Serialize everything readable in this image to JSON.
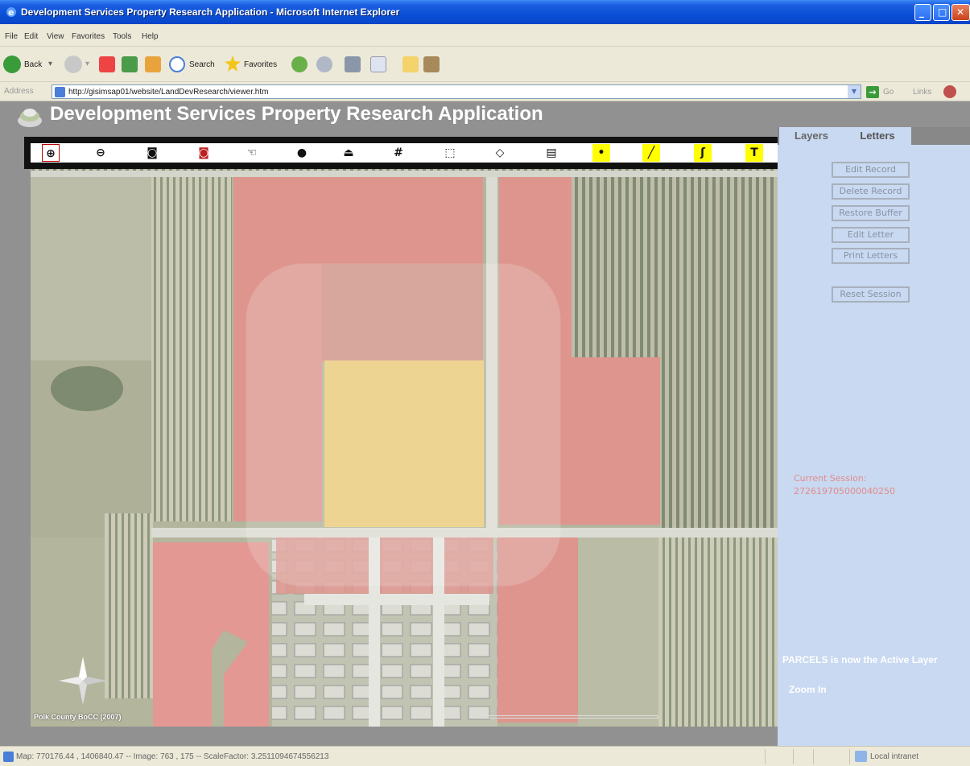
{
  "window": {
    "title": "Development Services Property Research Application - Microsoft Internet Explorer"
  },
  "menu": [
    "File",
    "Edit",
    "View",
    "Favorites",
    "Tools",
    "Help"
  ],
  "toolbar": {
    "back_label": "Back",
    "search_label": "Search",
    "favorites_label": "Favorites"
  },
  "address": {
    "label": "Address",
    "url": "http://gisimsap01/website/LandDevResearch/viewer.htm",
    "go_label": "Go",
    "links_label": "Links"
  },
  "app": {
    "title": "Development Services Property Research Application"
  },
  "map_tools": [
    {
      "name": "zoom-in-tool",
      "icon": "zoom-in-icon",
      "glyph": "⊕"
    },
    {
      "name": "zoom-out-tool",
      "icon": "zoom-out-icon",
      "glyph": "⊖"
    },
    {
      "name": "zoom-full-tool",
      "icon": "globe-icon",
      "glyph": "◙"
    },
    {
      "name": "zoom-active-tool",
      "icon": "globe-red-icon",
      "glyph": "◙"
    },
    {
      "name": "pan-tool",
      "icon": "hand-icon",
      "glyph": "☜"
    },
    {
      "name": "identify-tool",
      "icon": "info-icon",
      "glyph": "●"
    },
    {
      "name": "query-tool",
      "icon": "query-icon",
      "glyph": "⏏"
    },
    {
      "name": "measure-tool",
      "icon": "grid-icon",
      "glyph": "#"
    },
    {
      "name": "select-tool",
      "icon": "select-icon",
      "glyph": "⬚"
    },
    {
      "name": "clear-tool",
      "icon": "eraser-icon",
      "glyph": "◇"
    },
    {
      "name": "print-tool",
      "icon": "printer-icon",
      "glyph": "▤"
    },
    {
      "name": "point-tool",
      "icon": "point-icon",
      "glyph": "•"
    },
    {
      "name": "line-tool",
      "icon": "line-icon",
      "glyph": "╱"
    },
    {
      "name": "polyline-tool",
      "icon": "polyline-icon",
      "glyph": "ʃ"
    },
    {
      "name": "text-tool",
      "icon": "text-icon",
      "glyph": "T"
    }
  ],
  "map": {
    "credit": "Polk County BoCC (2007)"
  },
  "side_panel": {
    "tabs": [
      "Layers",
      "Letters"
    ],
    "buttons": [
      "Edit Record",
      "Delete Record",
      "Restore Buffer",
      "Edit Letter",
      "Print Letters",
      "Reset Session"
    ],
    "session_label": "Current Session:",
    "session_value": "272619705000040250",
    "active_layer_message": "PARCELS is now the Active Layer",
    "mode_status": "Zoom In"
  },
  "statusbar": {
    "text": "Map: 770176.44 , 1406840.47 -- Image: 763 , 175 -- ScaleFactor: 3.2511094674556213",
    "zone": "Local intranet"
  },
  "colors": {
    "parcel_selected": "#e8c46a",
    "parcel_notified": "#e98a8a",
    "panel_bg": "#c8d9f1"
  }
}
